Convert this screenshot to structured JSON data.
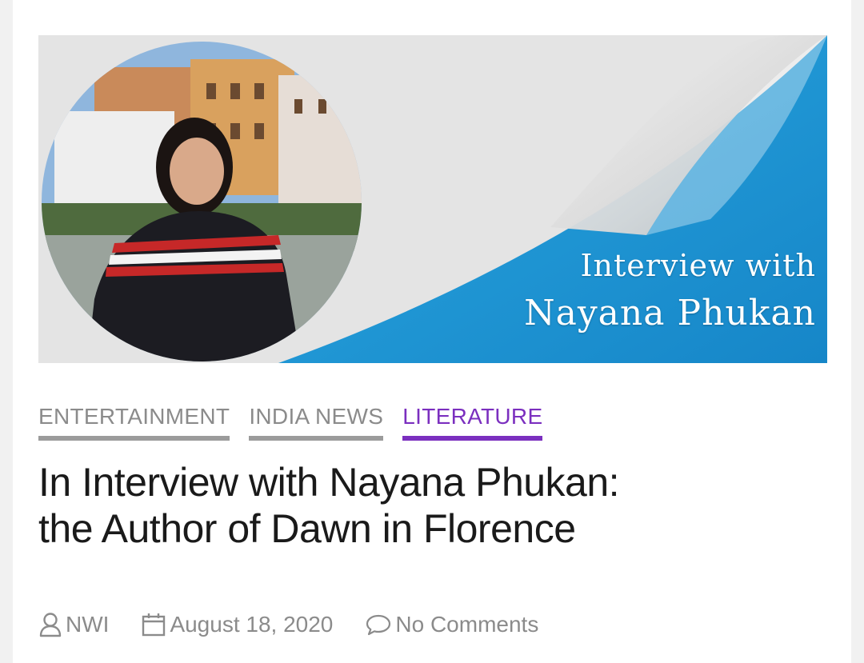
{
  "hero": {
    "line1": "Interview with",
    "line2": "Nayana Phukan"
  },
  "categories": [
    {
      "label": "ENTERTAINMENT",
      "active": false
    },
    {
      "label": "INDIA NEWS",
      "active": false
    },
    {
      "label": "LITERATURE",
      "active": true
    }
  ],
  "article": {
    "title_line1": "In Interview with Nayana Phukan:",
    "title_line2": "the Author of Dawn in Florence"
  },
  "meta": {
    "author": "NWI",
    "date": "August 18, 2020",
    "comments": "No Comments"
  },
  "icons": {
    "author": "user-icon",
    "date": "calendar-icon",
    "comments": "comment-icon"
  },
  "colors": {
    "accent": "#7b2fbf",
    "category": "#9b9b9b",
    "hero_blue": "#1f9ad6"
  }
}
